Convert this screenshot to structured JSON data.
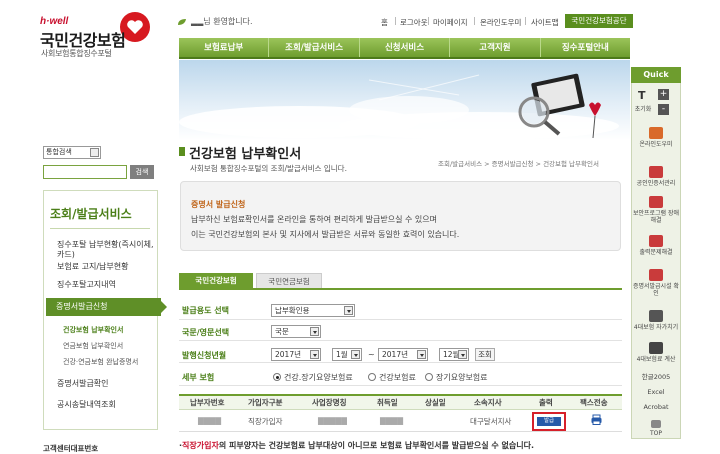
{
  "logo": {
    "brand": "h·well",
    "name": "국민건강보험",
    "subtitle": "사회보험통합징수포털"
  },
  "welcome": {
    "user": "▂▂님 환영합니다."
  },
  "util_links": [
    "홈",
    "로그아웃",
    "마이페이지",
    "온라인도우미",
    "사이트맵"
  ],
  "util_button": "국민건강보험공단",
  "nav": [
    "보험료납부",
    "조회/발급서비스",
    "신청서비스",
    "고객지원",
    "징수포털안내"
  ],
  "quick": {
    "title": "Quick",
    "items": [
      "초기화",
      "온라인도우미",
      "공인인증서관리",
      "보안프로그램 장애해결",
      "출력문제해결",
      "증명서발급시설 확인",
      "4대보험 자가치기",
      "4대보험료 계산",
      "한글2005",
      "Excel",
      "Acrobat",
      "TOP"
    ],
    "text_tools": [
      "T",
      "+",
      "-"
    ]
  },
  "sidebar": {
    "search_select": "통합검색",
    "search_button": "검색",
    "title": "조회/발급서비스",
    "items": [
      "징수포탈 납부현황(즉시이체, 카드)",
      "보험료 고지/납부현황",
      "징수포탈고지내역"
    ],
    "active": "증명서발급신청",
    "subs": [
      "건강보험 납부확인서",
      "연금보험 납부확인서",
      "건강·연금보험 완납증명서"
    ],
    "more": [
      "증명서발급확인",
      "공시송달내역조회"
    ],
    "footer": "고객센터대표번호"
  },
  "main": {
    "title": "건강보험 납부확인서",
    "desc": "사회보험 통합징수포털의 조회/발급서비스 입니다.",
    "breadcrumb": "조회/발급서비스 > 증명서발급신청 > 건강보험 납부확인서",
    "notice": {
      "title": "증명서 발급신청",
      "line1": "납부하신 보험료확인서를 온라인을 통하여 편리하게 발급받으실 수 있으며",
      "line2": "이는 국민건강보험의 본사 및 지사에서 발급받은 서류와 동일한 효력이 있습니다."
    },
    "tabs": [
      "국민건강보험",
      "국민연금보험"
    ]
  },
  "form": {
    "purpose_label": "발급용도 선택",
    "purpose_value": "납부확인용",
    "lang_label": "국문/영문선택",
    "lang_value": "국문",
    "period_label": "발행신청년월",
    "from_year": "2017년",
    "from_month": "1월",
    "range_sep": "~",
    "to_year": "2017년",
    "to_month": "12월",
    "query_button": "조회",
    "detail_label": "세부 보험",
    "options": [
      "건강.장기요양보험료",
      "건강보험료",
      "장기요양보험료"
    ]
  },
  "table": {
    "headers": [
      "납부자번호",
      "가입자구분",
      "사업장명칭",
      "취득일",
      "상실일",
      "소속지사",
      "출력",
      "팩스전송"
    ],
    "row": [
      "▇▇▇▇",
      "직장가입자",
      "▇▇▇▇▇",
      "▇▇▇▇",
      "",
      "대구달서지사",
      "발급",
      ""
    ]
  },
  "warning": {
    "bullet": "·",
    "red": "직장가입자",
    "rest": "의 피부양자는 건강보험료 납부대상이 아니므로 보험료 납부확인서를 발급받으실 수 없습니다."
  },
  "colors": {
    "brand_green": "#6e9d2e",
    "logo_red": "#c8102e",
    "highlight_red": "#d6202a",
    "print_blue": "#2659a8"
  }
}
